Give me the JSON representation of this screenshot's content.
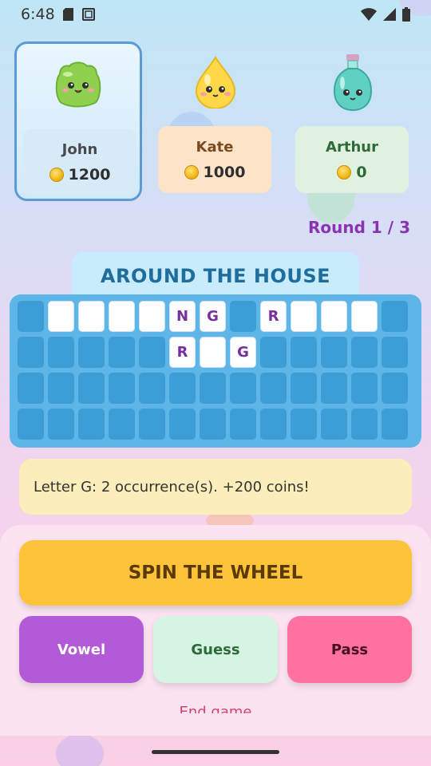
{
  "status_bar": {
    "time": "6:48"
  },
  "players": [
    {
      "name": "John",
      "score": "1200",
      "active": true
    },
    {
      "name": "Kate",
      "score": "1000",
      "active": false
    },
    {
      "name": "Arthur",
      "score": "0",
      "active": false
    }
  ],
  "round": "Round 1 / 3",
  "category": "AROUND THE HOUSE",
  "board": [
    [
      "",
      "_",
      "_",
      "_",
      "_",
      "N",
      "G",
      "",
      "R",
      "_",
      "_",
      "_",
      ""
    ],
    [
      "",
      "",
      "",
      "",
      "",
      "R",
      "_",
      "G",
      "",
      "",
      "",
      "",
      ""
    ],
    [
      "",
      "",
      "",
      "",
      "",
      "",
      "",
      "",
      "",
      "",
      "",
      "",
      ""
    ],
    [
      "",
      "",
      "",
      "",
      "",
      "",
      "",
      "",
      "",
      "",
      "",
      "",
      ""
    ]
  ],
  "message": "Letter G: 2 occurrence(s). +200 coins!",
  "buttons": {
    "spin": "SPIN THE WHEEL",
    "vowel": "Vowel",
    "guess": "Guess",
    "pass": "Pass",
    "end_game": "End game"
  },
  "colors": {
    "vowel": "#b25ad8",
    "guess": "#d6f4e4",
    "pass": "#fe71a1",
    "round_text": "#8a35b0"
  }
}
